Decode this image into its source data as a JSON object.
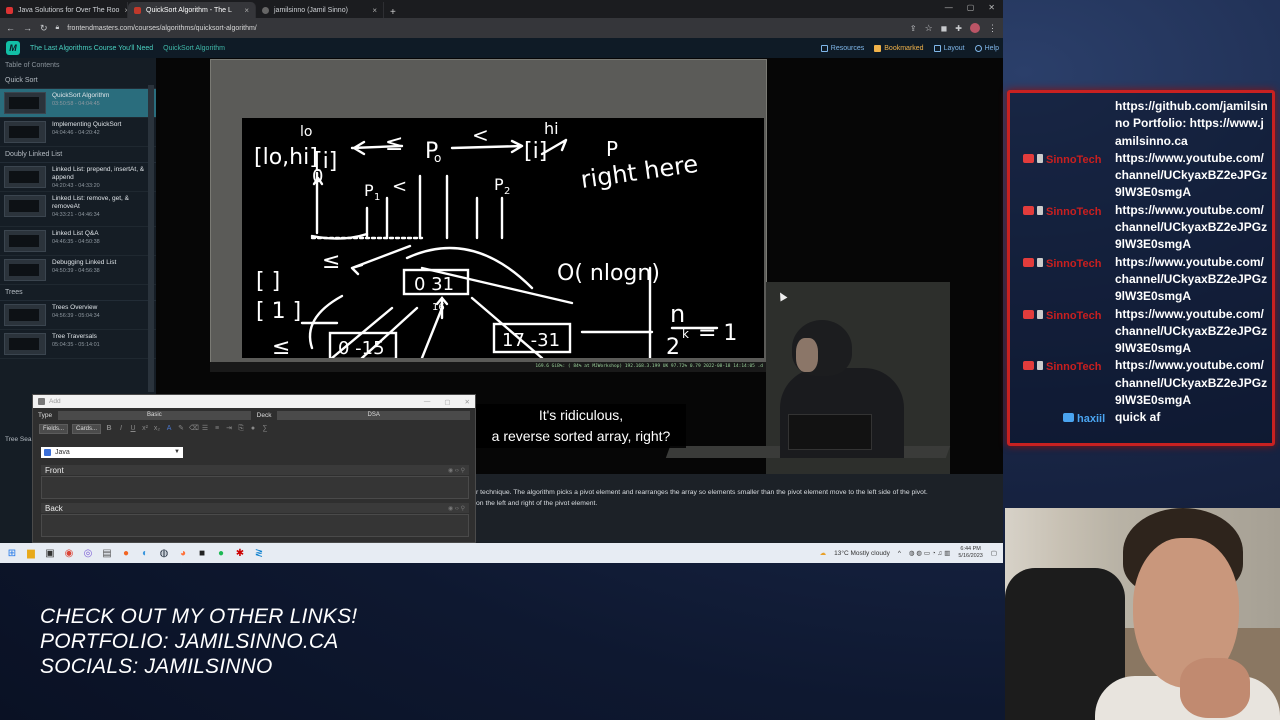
{
  "browser": {
    "tabs": [
      {
        "label": "Java Solutions for Over The Roo",
        "color": "#d33"
      },
      {
        "label": "QuickSort Algorithm - The L",
        "color": "#c0392b"
      },
      {
        "label": "jamilsinno (Jamil Sinno)",
        "color": "#666"
      }
    ],
    "new_tab": "+",
    "url": "frontendmasters.com/courses/algorithms/quicksort-algorithm/"
  },
  "site": {
    "logo": "M",
    "breadcrumb_course": "The Last Algorithms Course You'll Need",
    "breadcrumb_lesson": "QuickSort Algorithm",
    "nav": {
      "resources": "Resources",
      "bookmarked": "Bookmarked",
      "layout": "Layout",
      "help": "Help"
    }
  },
  "sidebar": {
    "heading": "Table of Contents",
    "sections": [
      {
        "title": "Quick Sort",
        "lessons": [
          {
            "title": "QuickSort Algorithm",
            "time": "03:50:58 - 04:04:45",
            "active": true
          },
          {
            "title": "Implementing QuickSort",
            "time": "04:04:46 - 04:20:42"
          }
        ]
      },
      {
        "title": "Doubly Linked List",
        "lessons": [
          {
            "title": "Linked List: prepend, insertAt, & append",
            "time": "04:20:43 - 04:33:20"
          },
          {
            "title": "Linked List: remove, get, & removeAt",
            "time": "04:33:21 - 04:46:34"
          },
          {
            "title": "Linked List Q&A",
            "time": "04:46:35 - 04:50:38"
          },
          {
            "title": "Debugging Linked List",
            "time": "04:50:39 - 04:56:38"
          }
        ]
      },
      {
        "title": "Trees",
        "lessons": [
          {
            "title": "Trees Overview",
            "time": "04:56:39 - 05:04:34"
          },
          {
            "title": "Tree Traversals",
            "time": "05:04:35 - 05:14:01"
          }
        ]
      }
    ],
    "partial_section": "Tree Sea"
  },
  "video": {
    "subtitle_line1": "It's ridiculous,",
    "subtitle_line2": "a reverse sorted array, right?",
    "status_text": "169.6 GiB%: ( 84% at MJWorkshop) 192.168.3.199 UK 97.72% 0.79 2022-08-18 14:14:05 .d",
    "description_line1": "r technique. The algorithm picks a pivot element and rearranges the array so elements smaller than the pivot element move to the left side of the pivot.",
    "description_line2": "on the left and right of the pivot element."
  },
  "anki": {
    "title": "Add",
    "type_label": "Type",
    "type_value": "Basic",
    "deck_label": "Deck",
    "deck_value": "DSA",
    "fields_btn": "Fields...",
    "cards_btn": "Cards...",
    "language": "Java",
    "front_label": "Front",
    "back_label": "Back"
  },
  "taskbar": {
    "weather": "13°C  Mostly cloudy",
    "time": "6:44 PM",
    "date": "5/16/2023"
  },
  "chat": {
    "messages": [
      {
        "user": "",
        "text": "https://github.com/jamilsinno Portfolio: https://www.jamilsinno.ca"
      },
      {
        "user": "SinnoTech",
        "text": "https://www.youtube.com/channel/UCkyaxBZ2eJPGz9lW3E0smgA"
      },
      {
        "user": "SinnoTech",
        "text": "https://www.youtube.com/channel/UCkyaxBZ2eJPGz9lW3E0smgA"
      },
      {
        "user": "SinnoTech",
        "text": "https://www.youtube.com/channel/UCkyaxBZ2eJPGz9lW3E0smgA"
      },
      {
        "user": "SinnoTech",
        "text": "https://www.youtube.com/channel/UCkyaxBZ2eJPGz9lW3E0smgA"
      },
      {
        "user": "SinnoTech",
        "text": "https://www.youtube.com/channel/UCkyaxBZ2eJPGz9lW3E0smgA"
      },
      {
        "user": "haxiil",
        "text": "quick af"
      }
    ]
  },
  "overlay": {
    "line1": "CHECK OUT MY OTHER LINKS!",
    "line2": "PORTFOLIO: JAMILSINNO.CA",
    "line3": "SOCIALS: JAMILSINNO"
  }
}
